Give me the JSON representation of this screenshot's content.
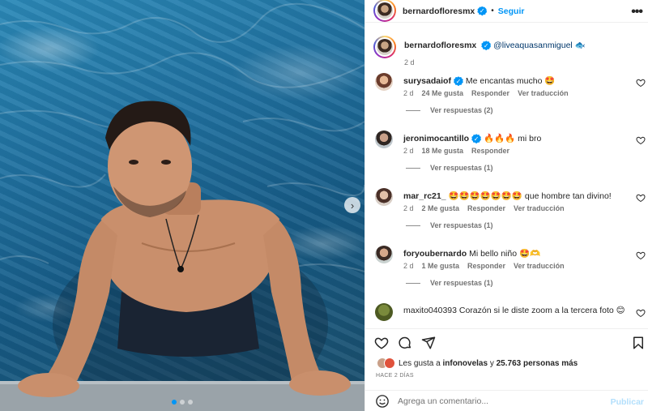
{
  "post": {
    "username": "bernardofloresmx",
    "separator": "•",
    "follow_label": "Seguir",
    "more_label": "•••",
    "caption": {
      "username": "bernardofloresmx",
      "mention": "@liveaquasanmiguel",
      "emoji": "🐟",
      "time": "2 d"
    }
  },
  "comments": [
    {
      "username": "surysadaiof",
      "verified": true,
      "text": "Me encantas mucho 🤩",
      "time": "2 d",
      "likes": "24 Me gusta",
      "reply_label": "Responder",
      "translate_label": "Ver traducción",
      "replies": "Ver respuestas (2)"
    },
    {
      "username": "jeronimocantillo",
      "verified": true,
      "text": "🔥🔥🔥 mi bro",
      "time": "2 d",
      "likes": "18 Me gusta",
      "reply_label": "Responder",
      "translate_label": "",
      "replies": "Ver respuestas (1)"
    },
    {
      "username": "mar_rc21_",
      "verified": false,
      "text": "🤩🤩🤩🤩🤩🤩🤩 que hombre tan divino!",
      "time": "2 d",
      "likes": "2 Me gusta",
      "reply_label": "Responder",
      "translate_label": "Ver traducción",
      "replies": "Ver respuestas (1)"
    },
    {
      "username": "foryoubernardo",
      "verified": false,
      "text": "Mi bello niño 🤩🫶",
      "time": "2 d",
      "likes": "1 Me gusta",
      "reply_label": "Responder",
      "translate_label": "Ver traducción",
      "replies": "Ver respuestas (1)"
    },
    {
      "username": "maxito040393",
      "verified": false,
      "text": "Corazón si le diste zoom a la tercera foto 😊",
      "time": "",
      "likes": "",
      "reply_label": "",
      "translate_label": "",
      "replies": ""
    }
  ],
  "likes_summary": {
    "prefix": "Les gusta a ",
    "user": "infonovelas",
    "middle": " y ",
    "count": "25.763 personas más"
  },
  "posted_ago": "HACE 2 DÍAS",
  "composer": {
    "placeholder": "Agrega un comentario...",
    "publish_label": "Publicar"
  },
  "icons": {
    "like": "heart-icon",
    "comment": "comment-icon",
    "share": "paper-plane-icon",
    "save": "bookmark-icon",
    "emoji": "smiley-icon",
    "next": "chevron-right-icon"
  },
  "colors": {
    "accent": "#0095f6",
    "publish_disabled": "#b2dffc",
    "link": "#00376b"
  }
}
